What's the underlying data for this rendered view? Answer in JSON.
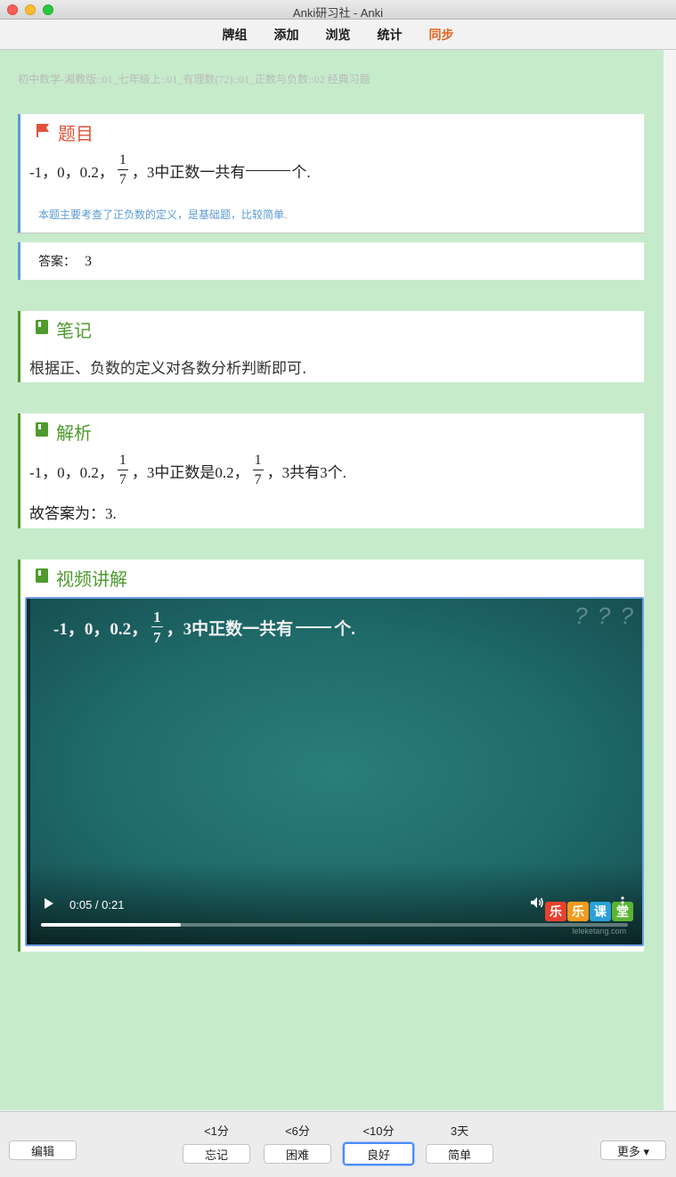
{
  "window": {
    "title": "Anki研习社 - Anki"
  },
  "toolbar": {
    "decks": "牌组",
    "add": "添加",
    "browse": "浏览",
    "stats": "统计",
    "sync": "同步"
  },
  "deck_path": "初中数学-湘教版::01_七年级上::01_有理数(72)::01_正数与负数::02 经典习题",
  "question": {
    "heading": "题目",
    "prefix": "-1，0，0.2，",
    "frac_num": "1",
    "frac_den": "7",
    "suffix_a": "，3中正数一共有",
    "suffix_b": "个.",
    "hint": "本题主要考查了正负数的定义，是基础题，比较简单."
  },
  "answer": {
    "label": "答案：",
    "value": "3"
  },
  "notes": {
    "heading": "笔记",
    "text": "根据正、负数的定义对各数分析判断即可."
  },
  "analysis": {
    "heading": "解析",
    "prefix": "-1，0，0.2，",
    "frac_num": "1",
    "frac_den": "7",
    "middle": "，3中正数是0.2，",
    "suffix": "，3共有3个.",
    "line2": "故答案为：3."
  },
  "video_section": {
    "heading": "视频讲解",
    "board_prefix": "-1，0，0.2，",
    "board_num": "1",
    "board_den": "7",
    "board_suffix_a": "，3中正数一共有",
    "board_suffix_b": "个.",
    "question_marks": "? ? ?",
    "time": "0:05 / 0:21",
    "progress_fraction": 0.238,
    "logo_chars": [
      "乐",
      "乐",
      "课",
      "堂"
    ],
    "logo_colors": [
      "#e8402f",
      "#f29a1d",
      "#2aa0d8",
      "#5bb431"
    ],
    "logo_sub": "leleketang.com"
  },
  "review": {
    "edit": "编辑",
    "more": "更多 ▾",
    "again_interval": "<1分",
    "again": "忘记",
    "hard_interval": "<6分",
    "hard": "困难",
    "good_interval": "<10分",
    "good": "良好",
    "easy_interval": "3天",
    "easy": "简单"
  },
  "colors": {
    "accent_sync": "#e0641d",
    "bg_green": "#c6ebcb",
    "question_red": "#e0533a",
    "section_green": "#4f9a2e",
    "hint_blue": "#5b9bd5"
  }
}
